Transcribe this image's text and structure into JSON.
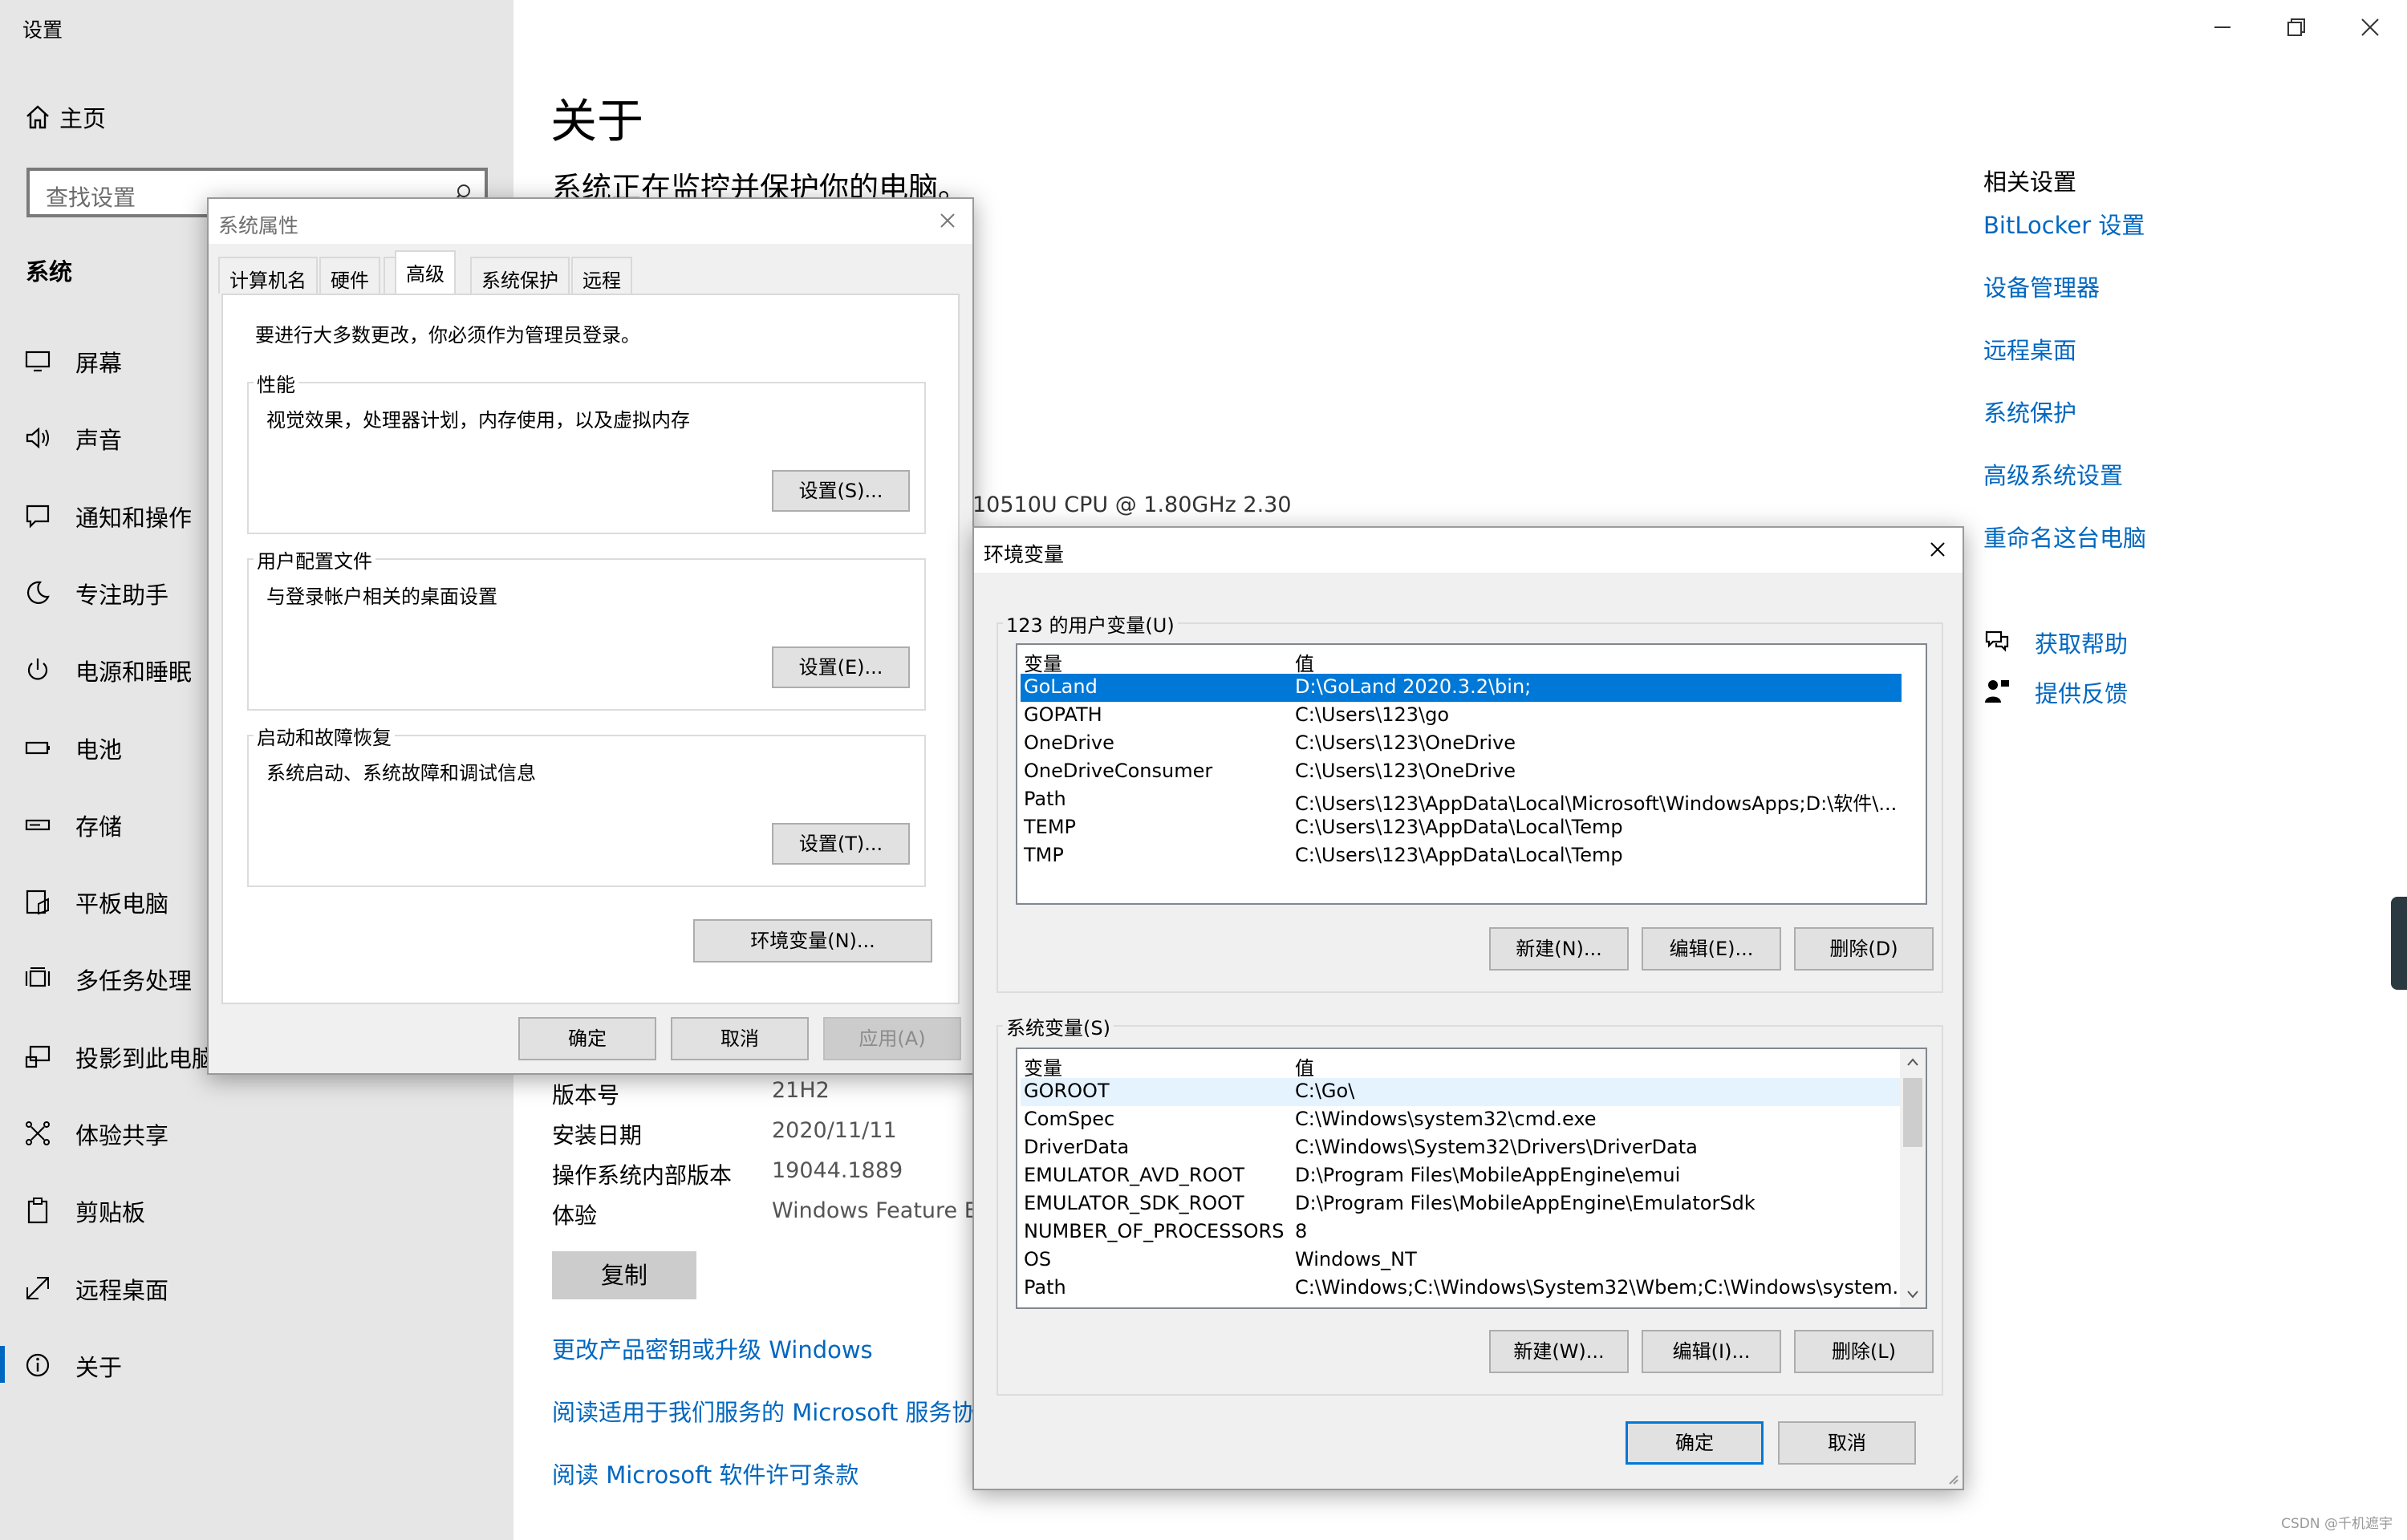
{
  "app": {
    "title": "设置"
  },
  "sidebar": {
    "home": "主页",
    "search_placeholder": "查找设置",
    "section": "系统",
    "items": [
      {
        "label": "屏幕",
        "icon": "monitor-icon"
      },
      {
        "label": "声音",
        "icon": "speaker-icon"
      },
      {
        "label": "通知和操作",
        "icon": "notification-icon"
      },
      {
        "label": "专注助手",
        "icon": "moon-icon"
      },
      {
        "label": "电源和睡眠",
        "icon": "power-icon"
      },
      {
        "label": "电池",
        "icon": "battery-icon"
      },
      {
        "label": "存储",
        "icon": "storage-icon"
      },
      {
        "label": "平板电脑",
        "icon": "tablet-icon"
      },
      {
        "label": "多任务处理",
        "icon": "multitask-icon"
      },
      {
        "label": "投影到此电脑",
        "icon": "project-icon"
      },
      {
        "label": "体验共享",
        "icon": "share-icon"
      },
      {
        "label": "剪贴板",
        "icon": "clipboard-icon"
      },
      {
        "label": "远程桌面",
        "icon": "remote-icon"
      },
      {
        "label": "关于",
        "icon": "info-icon",
        "active": true
      }
    ]
  },
  "main": {
    "title": "关于",
    "subtitle": "系统正在监控并保护你的电脑。",
    "cpu_fragment": "10510U CPU @ 1.80GHz   2.30",
    "specs": [
      {
        "label": "版本号",
        "value": "21H2"
      },
      {
        "label": "安装日期",
        "value": "2020/11/11"
      },
      {
        "label": "操作系统内部版本",
        "value": "19044.1889"
      },
      {
        "label": "体验",
        "value": "Windows Feature Ex"
      }
    ],
    "copy_button": "复制",
    "links": [
      "更改产品密钥或升级 Windows",
      "阅读适用于我们服务的 Microsoft 服务协议",
      "阅读 Microsoft 软件许可条款"
    ]
  },
  "related": {
    "title": "相关设置",
    "links": [
      "BitLocker 设置",
      "设备管理器",
      "远程桌面",
      "系统保护",
      "高级系统设置",
      "重命名这台电脑"
    ],
    "help": "获取帮助",
    "feedback": "提供反馈"
  },
  "sysprops": {
    "title": "系统属性",
    "tabs": [
      "计算机名",
      "硬件",
      "高级",
      "系统保护",
      "远程"
    ],
    "admin_note": "要进行大多数更改，你必须作为管理员登录。",
    "perf": {
      "title": "性能",
      "desc": "视觉效果，处理器计划，内存使用，以及虚拟内存",
      "button": "设置(S)..."
    },
    "profile": {
      "title": "用户配置文件",
      "desc": "与登录帐户相关的桌面设置",
      "button": "设置(E)..."
    },
    "startup": {
      "title": "启动和故障恢复",
      "desc": "系统启动、系统故障和调试信息",
      "button": "设置(T)..."
    },
    "env_button": "环境变量(N)...",
    "ok": "确定",
    "cancel": "取消",
    "apply": "应用(A)"
  },
  "envvars": {
    "title": "环境变量",
    "user_group": "123 的用户变量(U)",
    "col_var": "变量",
    "col_val": "值",
    "user_rows": [
      {
        "name": "GoLand",
        "value": "D:\\GoLand 2020.3.2\\bin;"
      },
      {
        "name": "GOPATH",
        "value": "C:\\Users\\123\\go"
      },
      {
        "name": "OneDrive",
        "value": "C:\\Users\\123\\OneDrive"
      },
      {
        "name": "OneDriveConsumer",
        "value": "C:\\Users\\123\\OneDrive"
      },
      {
        "name": "Path",
        "value": "C:\\Users\\123\\AppData\\Local\\Microsoft\\WindowsApps;D:\\软件\\..."
      },
      {
        "name": "TEMP",
        "value": "C:\\Users\\123\\AppData\\Local\\Temp"
      },
      {
        "name": "TMP",
        "value": "C:\\Users\\123\\AppData\\Local\\Temp"
      }
    ],
    "user_buttons": [
      "新建(N)...",
      "编辑(E)...",
      "删除(D)"
    ],
    "sys_group": "系统变量(S)",
    "sys_rows": [
      {
        "name": "GOROOT",
        "value": "C:\\Go\\"
      },
      {
        "name": "ComSpec",
        "value": "C:\\Windows\\system32\\cmd.exe"
      },
      {
        "name": "DriverData",
        "value": "C:\\Windows\\System32\\Drivers\\DriverData"
      },
      {
        "name": "EMULATOR_AVD_ROOT",
        "value": "D:\\Program Files\\MobileAppEngine\\emui"
      },
      {
        "name": "EMULATOR_SDK_ROOT",
        "value": "D:\\Program Files\\MobileAppEngine\\EmulatorSdk"
      },
      {
        "name": "NUMBER_OF_PROCESSORS",
        "value": "8"
      },
      {
        "name": "OS",
        "value": "Windows_NT"
      },
      {
        "name": "Path",
        "value": "C:\\Windows;C:\\Windows\\System32\\Wbem;C:\\Windows\\system..."
      }
    ],
    "sys_buttons": [
      "新建(W)...",
      "编辑(I)...",
      "删除(L)"
    ],
    "ok": "确定",
    "cancel": "取消"
  },
  "watermark": "CSDN @千机遮宇",
  "colors": {
    "accent": "#0067c0",
    "selection": "#0078d7",
    "sidebar_bg": "#e6e6e6",
    "dialog_bg": "#f0f0f0"
  }
}
